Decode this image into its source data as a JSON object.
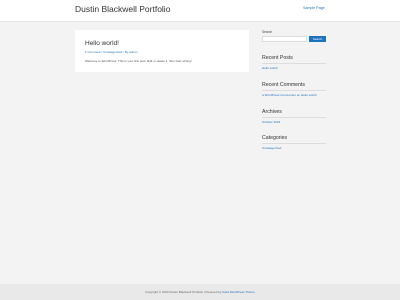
{
  "header": {
    "site_title": "Dustin Blackwell Portfolio",
    "nav_items": [
      "Sample Page"
    ]
  },
  "post": {
    "title": "Hello world!",
    "meta": "1 Comment / Uncategorized / By admin",
    "excerpt": "Welcome to WordPress. This is your first post. Edit or delete it, then start writing!"
  },
  "sidebar": {
    "search": {
      "label": "Search",
      "placeholder": "",
      "button": "Search"
    },
    "recent_posts": {
      "title": "Recent Posts",
      "items": [
        "Hello world!"
      ]
    },
    "recent_comments": {
      "title": "Recent Comments",
      "items": [
        "A WordPress Commenter on Hello world!"
      ]
    },
    "archives": {
      "title": "Archives",
      "items": [
        "October 2023"
      ]
    },
    "categories": {
      "title": "Categories",
      "items": [
        "Uncategorized"
      ]
    }
  },
  "footer": {
    "text": "Copyright © 2023 Dustin Blackwell Portfolio | Powered by",
    "link": "Astra WordPress Theme"
  },
  "colors": {
    "accent": "#1e73be",
    "background": "#f3f3f3",
    "card": "#ffffff",
    "footer": "#e9e9e9"
  }
}
